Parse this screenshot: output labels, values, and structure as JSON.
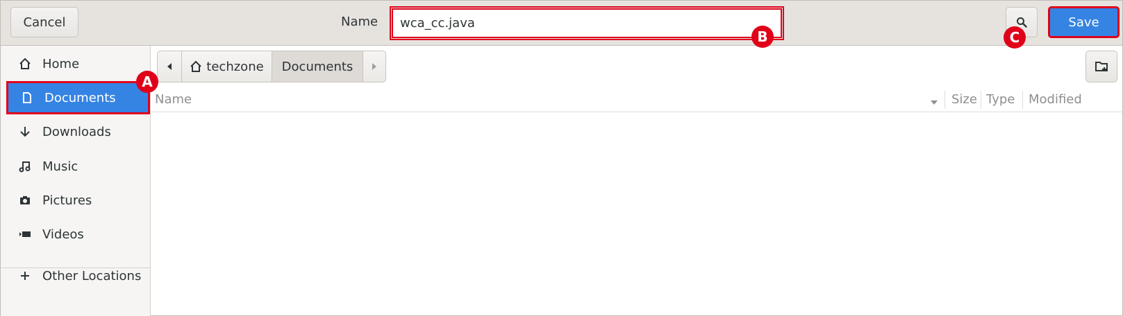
{
  "header": {
    "cancel_label": "Cancel",
    "name_label": "Name",
    "name_value": "wca_cc.java",
    "save_label": "Save"
  },
  "sidebar": {
    "items": [
      {
        "label": "Home",
        "icon": "home-icon"
      },
      {
        "label": "Documents",
        "icon": "document-icon",
        "selected": true
      },
      {
        "label": "Downloads",
        "icon": "download-icon"
      },
      {
        "label": "Music",
        "icon": "music-icon"
      },
      {
        "label": "Pictures",
        "icon": "camera-icon"
      },
      {
        "label": "Videos",
        "icon": "video-icon"
      },
      {
        "label": "Other Locations",
        "icon": "plus-icon"
      }
    ]
  },
  "pathbar": {
    "segments": [
      "techzone",
      "Documents"
    ]
  },
  "list": {
    "columns": [
      "Name",
      "Size",
      "Type",
      "Modified"
    ]
  },
  "annotations": [
    "A",
    "B",
    "C"
  ],
  "colors": {
    "accent": "#3584e4",
    "highlight": "#e0001a"
  }
}
